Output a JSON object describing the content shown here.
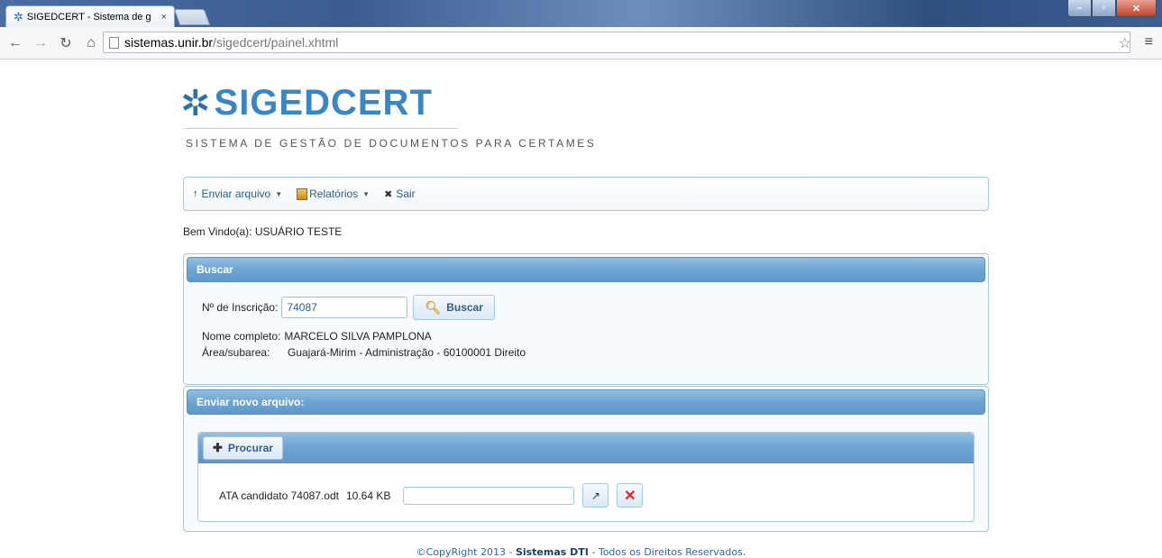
{
  "browser": {
    "tab_title": "SIGEDCERT - Sistema de g",
    "tab_close": "×",
    "url_host": "sistemas.unir.br",
    "url_path": "/sigedcert/painel.xhtml",
    "icons": [
      "back-arrow-icon",
      "forward-arrow-icon",
      "reload-icon",
      "home-icon",
      "page-icon",
      "star-icon",
      "menu-icon"
    ]
  },
  "header": {
    "logo_text": "SIGEDCERT",
    "subtitle": "SISTEMA DE GESTÃO DE DOCUMENTOS PARA CERTAMES"
  },
  "menu": {
    "enviar": "Enviar arquivo",
    "relatorios": "Relatórios",
    "sair": "Sair"
  },
  "welcome": "Bem Vindo(a): USUÁRIO TESTE",
  "buscar_panel": {
    "title": "Buscar",
    "inscricao_label": "Nº de Inscrição:",
    "inscricao_value": "74087",
    "button": "Buscar",
    "nome_label": "Nome completo:",
    "nome_value": "MARCELO SILVA PAMPLONA",
    "area_label": "Área/subarea:",
    "area_value": "Guajará-Mirim - Administração - 60100001 Direito"
  },
  "enviar_panel": {
    "title": "Enviar novo arquivo:",
    "procurar": "Procurar",
    "file_name": "ATA candidato 74087.odt",
    "file_size": "10.64 KB"
  },
  "footer": {
    "prefix": "©CopyRight 2013 - ",
    "brand": "Sistemas DTI",
    "suffix": " - Todos os Direitos Reservados."
  },
  "colors": {
    "brand_blue": "#3a85c3",
    "panel_header": "#6fa6d4",
    "cancel_red": "#dd2222"
  }
}
